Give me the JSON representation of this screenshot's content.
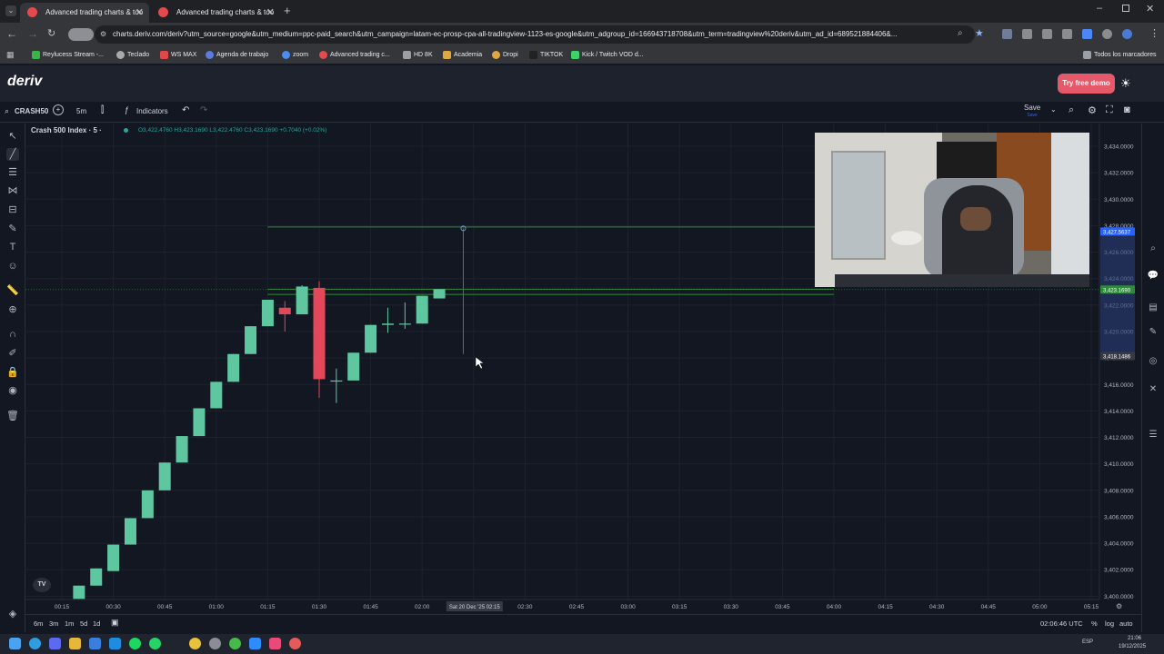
{
  "browser": {
    "tabs": [
      {
        "title": "Advanced trading charts & too",
        "active": true
      },
      {
        "title": "Advanced trading charts & too",
        "active": false
      }
    ],
    "url": "charts.deriv.com/deriv?utm_source=google&utm_medium=ppc-paid_search&utm_campaign=latam-ec-prosp-cpa-all-tradingview-1123-es-google&utm_adgroup_id=166943718708&utm_term=tradingview%20deriv&utm_ad_id=689521884406&...",
    "bookmarks": [
      "Reylucess Stream -...",
      "Teclado",
      "WS MAX",
      "Agenda de trabajo",
      "zoom",
      "Advanced trading c...",
      "HD 8K",
      "Academia",
      "Dropi",
      "TIKTOK",
      "Kick / Twitch VOD d..."
    ],
    "all_bookmarks": "Todos los marcadores"
  },
  "app": {
    "logo": "deriv",
    "try_demo": "Try free demo"
  },
  "toolbar": {
    "symbol": "CRASH50",
    "interval": "5m",
    "indicators": "Indicators",
    "save": "Save",
    "save_sub": "Save"
  },
  "chart": {
    "title": "Crash 500 Index · 5 ·",
    "ohlc": "O3,422.4760 H3,423.1690 L3,422.4760 C3,423.1690 +0.7040 (+0.02%)",
    "crosshair_time": "Sat 20 Dec '25   02:15",
    "price_labels": {
      "line_upper": "3,427.5637",
      "last": "3,423.1690",
      "cursor": "3,418.1486"
    },
    "colors": {
      "up": "#5fc7a0",
      "down": "#e2485a",
      "line": "#2f8a3c",
      "bg": "#131722"
    }
  },
  "chart_data": {
    "type": "candlestick",
    "x_ticks": [
      "00:15",
      "00:30",
      "00:45",
      "01:00",
      "01:15",
      "01:30",
      "01:45",
      "02:00",
      "02:15",
      "02:30",
      "02:45",
      "03:00",
      "03:15",
      "03:30",
      "03:45",
      "04:00",
      "04:15",
      "04:30",
      "04:45",
      "05:00",
      "05:15"
    ],
    "y_ticks": [
      3434,
      3432,
      3430,
      3428,
      3426,
      3424,
      3422,
      3420,
      3418,
      3416,
      3414,
      3412,
      3410,
      3408,
      3406,
      3404,
      3402,
      3400
    ],
    "y_tick_labels": [
      "3,434.0000",
      "3,432.0000",
      "3,430.0000",
      "3,428.0000",
      "3,426.0000",
      "3,424.0000",
      "3,422.0000",
      "3,420.0000",
      "3,418.0000",
      "3,416.0000",
      "3,414.0000",
      "3,412.0000",
      "3,410.0000",
      "3,408.0000",
      "3,406.0000",
      "3,404.0000",
      "3,402.0000",
      "3,400.0000"
    ],
    "ylim": [
      3399.8,
      3435.0
    ],
    "candles": [
      {
        "t": "00:20",
        "o": 3399.8,
        "h": 3400.8,
        "c": 3400.8,
        "l": 3399.8
      },
      {
        "t": "00:25",
        "o": 3400.8,
        "h": 3402.1,
        "c": 3402.1,
        "l": 3400.8
      },
      {
        "t": "00:30",
        "o": 3401.9,
        "h": 3403.9,
        "c": 3403.9,
        "l": 3401.9
      },
      {
        "t": "00:35",
        "o": 3403.9,
        "h": 3405.9,
        "c": 3405.9,
        "l": 3403.9
      },
      {
        "t": "00:40",
        "o": 3405.9,
        "h": 3408.0,
        "c": 3408.0,
        "l": 3405.9
      },
      {
        "t": "00:45",
        "o": 3408.0,
        "h": 3410.1,
        "c": 3410.1,
        "l": 3408.0
      },
      {
        "t": "00:50",
        "o": 3410.1,
        "h": 3412.1,
        "c": 3412.1,
        "l": 3410.1
      },
      {
        "t": "00:55",
        "o": 3412.1,
        "h": 3414.2,
        "c": 3414.2,
        "l": 3412.1
      },
      {
        "t": "01:00",
        "o": 3414.2,
        "h": 3416.2,
        "c": 3416.2,
        "l": 3414.2
      },
      {
        "t": "01:05",
        "o": 3416.2,
        "h": 3418.3,
        "c": 3418.3,
        "l": 3416.2
      },
      {
        "t": "01:10",
        "o": 3418.3,
        "h": 3420.4,
        "c": 3420.4,
        "l": 3418.3
      },
      {
        "t": "01:15",
        "o": 3420.4,
        "h": 3422.4,
        "c": 3422.4,
        "l": 3420.4
      },
      {
        "t": "01:20",
        "o": 3421.8,
        "h": 3422.3,
        "c": 3421.3,
        "l": 3420.0
      },
      {
        "t": "01:25",
        "o": 3421.3,
        "h": 3423.5,
        "c": 3423.4,
        "l": 3421.3
      },
      {
        "t": "01:30",
        "o": 3423.3,
        "h": 3423.8,
        "c": 3416.4,
        "l": 3415.0
      },
      {
        "t": "01:35",
        "o": 3416.3,
        "h": 3417.2,
        "c": 3416.3,
        "l": 3414.6
      },
      {
        "t": "01:40",
        "o": 3416.3,
        "h": 3418.4,
        "c": 3418.4,
        "l": 3416.3
      },
      {
        "t": "01:45",
        "o": 3418.4,
        "h": 3420.5,
        "c": 3420.5,
        "l": 3418.4
      },
      {
        "t": "01:50",
        "o": 3420.5,
        "h": 3421.8,
        "c": 3420.6,
        "l": 3419.9
      },
      {
        "t": "01:55",
        "o": 3420.6,
        "h": 3422.2,
        "c": 3420.6,
        "l": 3420.2
      },
      {
        "t": "02:00",
        "o": 3420.6,
        "h": 3422.7,
        "c": 3422.7,
        "l": 3420.6
      },
      {
        "t": "02:05",
        "o": 3422.5,
        "h": 3423.2,
        "c": 3423.2,
        "l": 3422.5
      }
    ],
    "lines": [
      {
        "value": 3427.9,
        "from": "01:15",
        "to": "04:00"
      },
      {
        "value": 3423.2,
        "from": "01:15",
        "to": "04:00"
      },
      {
        "value": 3422.8,
        "from": "01:15",
        "to": "04:00"
      }
    ]
  },
  "bottombar": {
    "ranges": [
      "6m",
      "3m",
      "1m",
      "5d",
      "1d"
    ],
    "clock": "02:06:46 UTC",
    "percent": "%",
    "log": "log",
    "auto": "auto"
  },
  "taskbar": {
    "lang": "ESP",
    "time": "21:06",
    "date": "19/12/2025"
  }
}
